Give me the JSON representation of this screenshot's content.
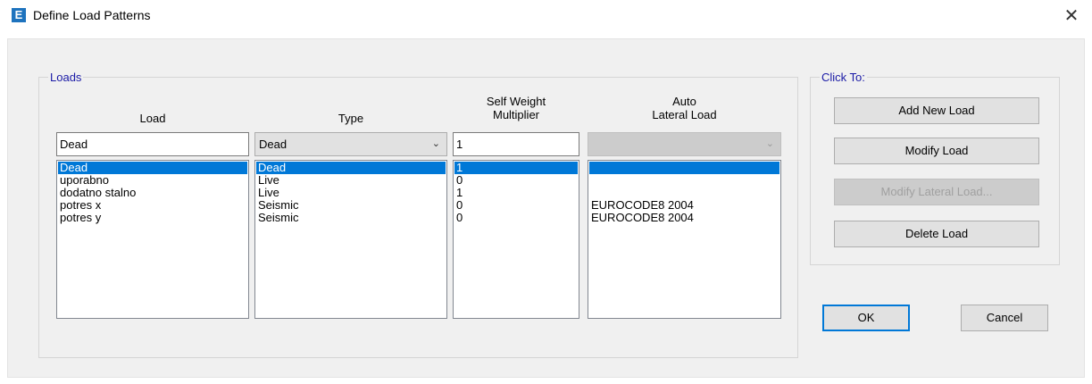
{
  "window": {
    "title": "Define Load Patterns",
    "icon_letter": "E",
    "close_glyph": "✕"
  },
  "loads_group": {
    "label": "Loads",
    "headers": {
      "load": "Load",
      "type": "Type",
      "self_weight_line1": "Self Weight",
      "self_weight_line2": "Multiplier",
      "auto_line1": "Auto",
      "auto_line2": "Lateral Load"
    },
    "inputs": {
      "load_name": "Dead",
      "type": "Dead",
      "self_weight": "1",
      "auto_lateral": ""
    },
    "rows": [
      {
        "load": "Dead",
        "type": "Dead",
        "multiplier": "1",
        "auto_lateral": ""
      },
      {
        "load": "uporabno",
        "type": "Live",
        "multiplier": "0",
        "auto_lateral": ""
      },
      {
        "load": "dodatno stalno",
        "type": "Live",
        "multiplier": "1",
        "auto_lateral": ""
      },
      {
        "load": "potres x",
        "type": "Seismic",
        "multiplier": "0",
        "auto_lateral": "EUROCODE8 2004"
      },
      {
        "load": "potres y",
        "type": "Seismic",
        "multiplier": "0",
        "auto_lateral": "EUROCODE8 2004"
      }
    ]
  },
  "click_to_group": {
    "label": "Click To:",
    "add_new_load": "Add New Load",
    "modify_load": "Modify Load",
    "modify_lateral_load": "Modify Lateral Load...",
    "delete_load": "Delete Load"
  },
  "footer": {
    "ok": "OK",
    "cancel": "Cancel"
  },
  "colors": {
    "selection": "#0078d7",
    "group_label": "#1a1aa6",
    "dialog_bg": "#f0f0f0"
  }
}
